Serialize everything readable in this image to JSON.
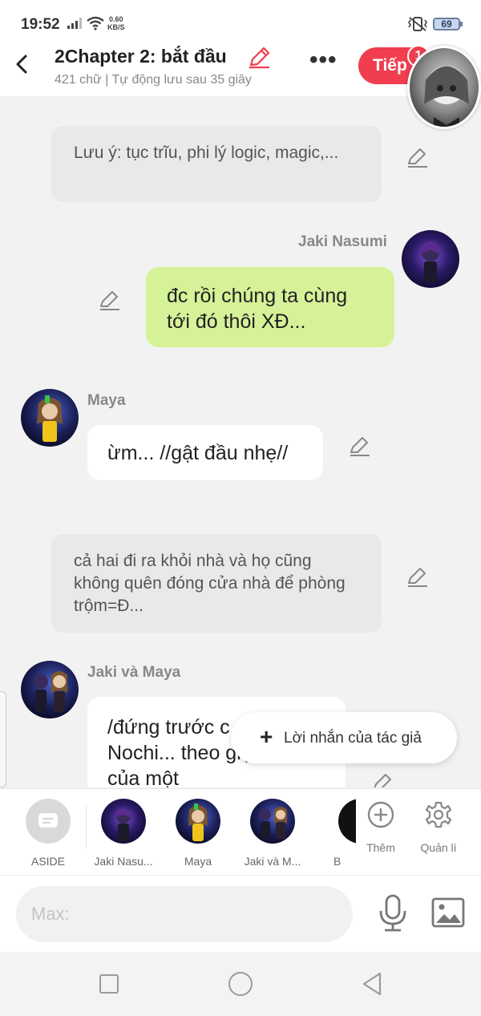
{
  "status_bar": {
    "time": "19:52",
    "net_speed_value": "0.60",
    "net_speed_unit": "KB/S",
    "battery": "69"
  },
  "header": {
    "title": "2Chapter 2: bắt đầu",
    "meta": "421 chữ | Tự động lưu sau 35 giây",
    "more_label": "•••",
    "next_label": "Tiếp",
    "badge_count": "1"
  },
  "chat": {
    "messages": [
      {
        "type": "narration",
        "text": "Lưu ý: tục trĩu, phi lý logic, magic,..."
      },
      {
        "type": "message",
        "side": "right",
        "speaker": "Jaki Nasumi",
        "text": "đc rồi chúng ta cùng tới đó thôi XĐ..."
      },
      {
        "type": "message",
        "side": "left",
        "speaker": "Maya",
        "text": "ừm... //gật đầu nhẹ//"
      },
      {
        "type": "narration",
        "text": "cả hai đi ra khỏi nhà và họ cũng không quên đóng cửa nhà để phòng trộm=Đ..."
      },
      {
        "type": "message",
        "side": "left",
        "speaker": "Jaki và Maya",
        "text": "/đứng trước c... trường Nochi... theo giọng nói của một"
      }
    ],
    "author_note_label": "Lời nhắn của tác giả"
  },
  "characters": {
    "items": [
      {
        "label": "ASIDE"
      },
      {
        "label": "Jaki Nasu..."
      },
      {
        "label": "Maya"
      },
      {
        "label": "Jaki và M..."
      },
      {
        "label": "B"
      }
    ],
    "add_label": "Thêm",
    "manage_label": "Quản lí"
  },
  "input": {
    "placeholder": "Max:"
  },
  "colors": {
    "accent": "#f03e4f",
    "my_bubble": "#d6f299",
    "narration_bg": "#e9e9e9",
    "background": "#f2f2f2"
  }
}
